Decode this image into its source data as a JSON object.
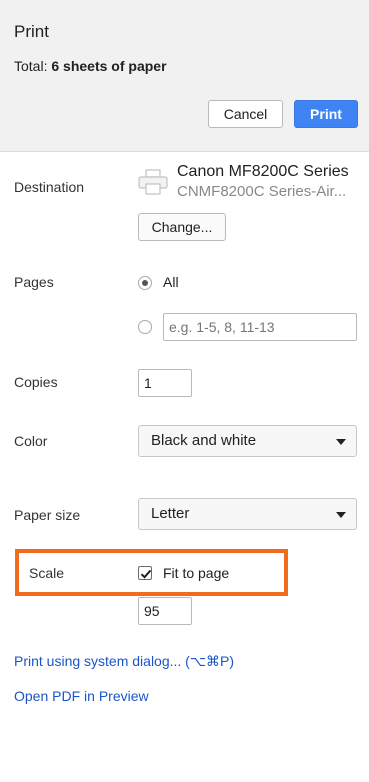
{
  "header": {
    "title": "Print",
    "total_label": "Total:",
    "total_value": "6 sheets of paper",
    "cancel_label": "Cancel",
    "print_label": "Print"
  },
  "destination": {
    "label": "Destination",
    "printer_name": "Canon MF8200C Series",
    "printer_sub": "CNMF8200C Series-Air...",
    "change_label": "Change..."
  },
  "pages": {
    "label": "Pages",
    "all_label": "All",
    "all_selected": true,
    "custom_placeholder": "e.g. 1-5, 8, 11-13"
  },
  "copies": {
    "label": "Copies",
    "value": "1"
  },
  "color": {
    "label": "Color",
    "selected": "Black and white"
  },
  "paper_size": {
    "label": "Paper size",
    "selected": "Letter"
  },
  "scale": {
    "label": "Scale",
    "fit_label": "Fit to page",
    "fit_checked": true,
    "value": "95"
  },
  "links": {
    "system_dialog": "Print using system dialog... (⌥⌘P)",
    "open_pdf": "Open PDF in Preview"
  },
  "colors": {
    "print_button": "#3f84f5",
    "highlight": "#f06a1f",
    "link": "#1a55c9"
  }
}
